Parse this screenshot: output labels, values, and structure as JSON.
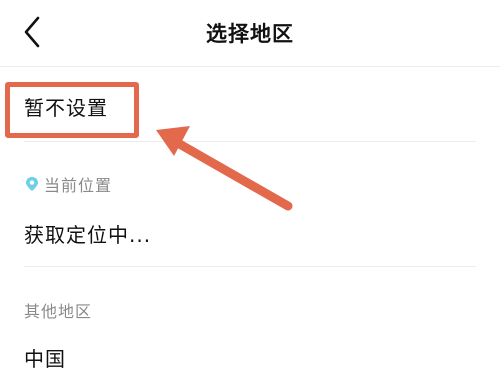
{
  "header": {
    "title": "选择地区",
    "back_icon": "chevron-left-icon"
  },
  "options": {
    "no_setting_label": "暂不设置"
  },
  "current_location": {
    "section_label": "当前位置",
    "icon": "location-pin-icon",
    "status_text": "获取定位中..."
  },
  "other_regions": {
    "section_label": "其他地区",
    "items": [
      {
        "label": "中国"
      }
    ]
  },
  "annotation": {
    "color": "#e3694d",
    "icon": "arrow-icon"
  },
  "colors": {
    "accent_pin": "#6ecfe8",
    "divider": "#ececec",
    "muted_text": "#8a8a8a"
  }
}
